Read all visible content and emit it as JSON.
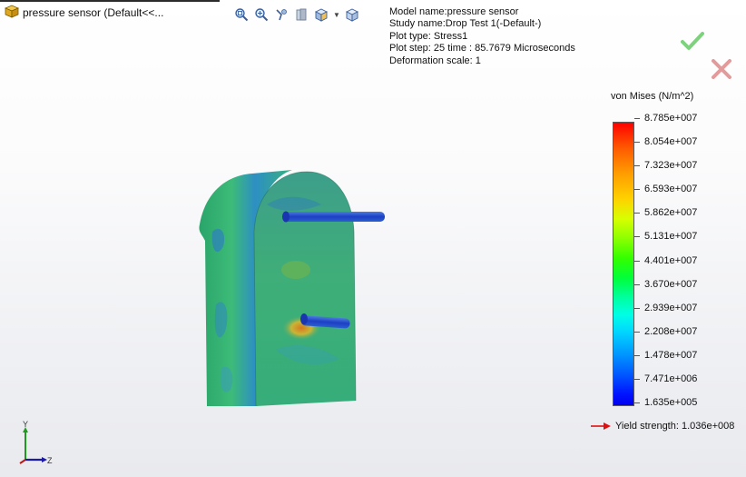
{
  "document": {
    "title": "pressure sensor  (Default<<...",
    "icon": "part-icon"
  },
  "heads_up_toolbar": {
    "items": [
      {
        "name": "zoom-to-fit-icon"
      },
      {
        "name": "zoom-to-area-icon"
      },
      {
        "name": "previous-view-icon"
      },
      {
        "name": "section-view-icon"
      },
      {
        "name": "view-orientation-icon"
      },
      {
        "name": "display-style-icon"
      }
    ]
  },
  "plot_info": {
    "model_name": "Model name:pressure sensor",
    "study_name": "Study name:Drop Test 1(-Default-)",
    "plot_type": "Plot type:  Stress1",
    "plot_step": "Plot step: 25   time : 85.7679 Microseconds",
    "deformation_scale": "Deformation scale: 1"
  },
  "confirm": {
    "icon": "checkmark-icon",
    "color": "#7ed27e"
  },
  "cancel": {
    "icon": "close-x-icon",
    "color": "#e39a9a"
  },
  "legend": {
    "title": "von Mises (N/m^2)",
    "ticks": [
      "8.785e+007",
      "8.054e+007",
      "7.323e+007",
      "6.593e+007",
      "5.862e+007",
      "5.131e+007",
      "4.401e+007",
      "3.670e+007",
      "2.939e+007",
      "2.208e+007",
      "1.478e+007",
      "7.471e+006",
      "1.635e+005"
    ],
    "max_color": "#ff0000",
    "min_color": "#0000f0"
  },
  "yield_strength": {
    "label": "Yield strength: 1.036e+008",
    "arrow_color": "#e01010"
  },
  "triad": {
    "y_label": "Y",
    "z_label": "Z"
  }
}
